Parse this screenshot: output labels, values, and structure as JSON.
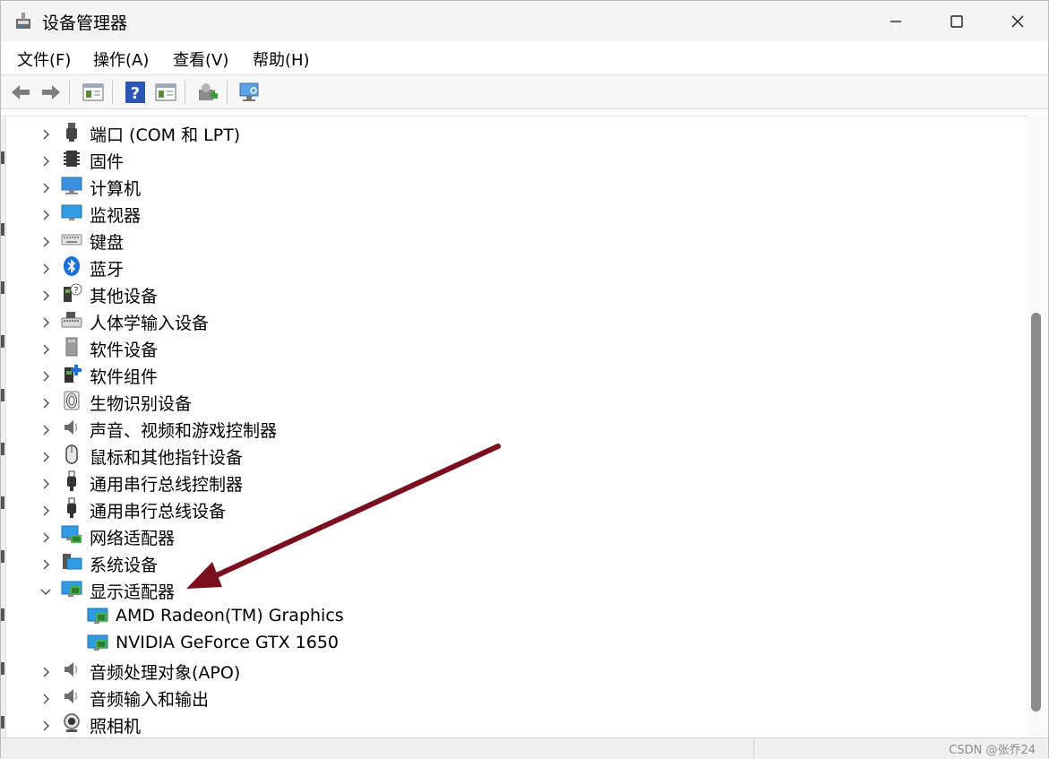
{
  "window": {
    "title": "设备管理器"
  },
  "menu": [
    "文件(F)",
    "操作(A)",
    "查看(V)",
    "帮助(H)"
  ],
  "toolbar_icons": [
    "back-icon",
    "forward-icon",
    "show-hide-tree-icon",
    "help-icon",
    "properties-icon",
    "update-driver-icon",
    "scan-hardware-icon"
  ],
  "tree": {
    "categories": [
      {
        "label": "端口 (COM 和 LPT)",
        "icon": "port-icon",
        "expanded": false
      },
      {
        "label": "固件",
        "icon": "firmware-icon",
        "expanded": false
      },
      {
        "label": "计算机",
        "icon": "computer-icon",
        "expanded": false
      },
      {
        "label": "监视器",
        "icon": "monitor-icon",
        "expanded": false
      },
      {
        "label": "键盘",
        "icon": "keyboard-icon",
        "expanded": false
      },
      {
        "label": "蓝牙",
        "icon": "bluetooth-icon",
        "expanded": false
      },
      {
        "label": "其他设备",
        "icon": "other-devices-icon",
        "expanded": false
      },
      {
        "label": "人体学输入设备",
        "icon": "hid-icon",
        "expanded": false
      },
      {
        "label": "软件设备",
        "icon": "software-device-icon",
        "expanded": false
      },
      {
        "label": "软件组件",
        "icon": "software-component-icon",
        "expanded": false
      },
      {
        "label": "生物识别设备",
        "icon": "biometric-icon",
        "expanded": false
      },
      {
        "label": "声音、视频和游戏控制器",
        "icon": "sound-icon",
        "expanded": false
      },
      {
        "label": "鼠标和其他指针设备",
        "icon": "mouse-icon",
        "expanded": false
      },
      {
        "label": "通用串行总线控制器",
        "icon": "usb-icon",
        "expanded": false
      },
      {
        "label": "通用串行总线设备",
        "icon": "usb-icon",
        "expanded": false
      },
      {
        "label": "网络适配器",
        "icon": "network-adapter-icon",
        "expanded": false
      },
      {
        "label": "系统设备",
        "icon": "system-device-icon",
        "expanded": false
      },
      {
        "label": "显示适配器",
        "icon": "display-adapter-icon",
        "expanded": true,
        "children": [
          "AMD Radeon(TM) Graphics",
          "NVIDIA GeForce GTX 1650"
        ]
      },
      {
        "label": "音频处理对象(APO)",
        "icon": "sound-icon",
        "expanded": false
      },
      {
        "label": "音频输入和输出",
        "icon": "sound-icon",
        "expanded": false
      },
      {
        "label": "照相机",
        "icon": "camera-icon",
        "expanded": false
      }
    ]
  },
  "status": {
    "watermark": "CSDN @张乔24"
  },
  "annotation": {
    "arrow_color": "#7a0f1f"
  }
}
